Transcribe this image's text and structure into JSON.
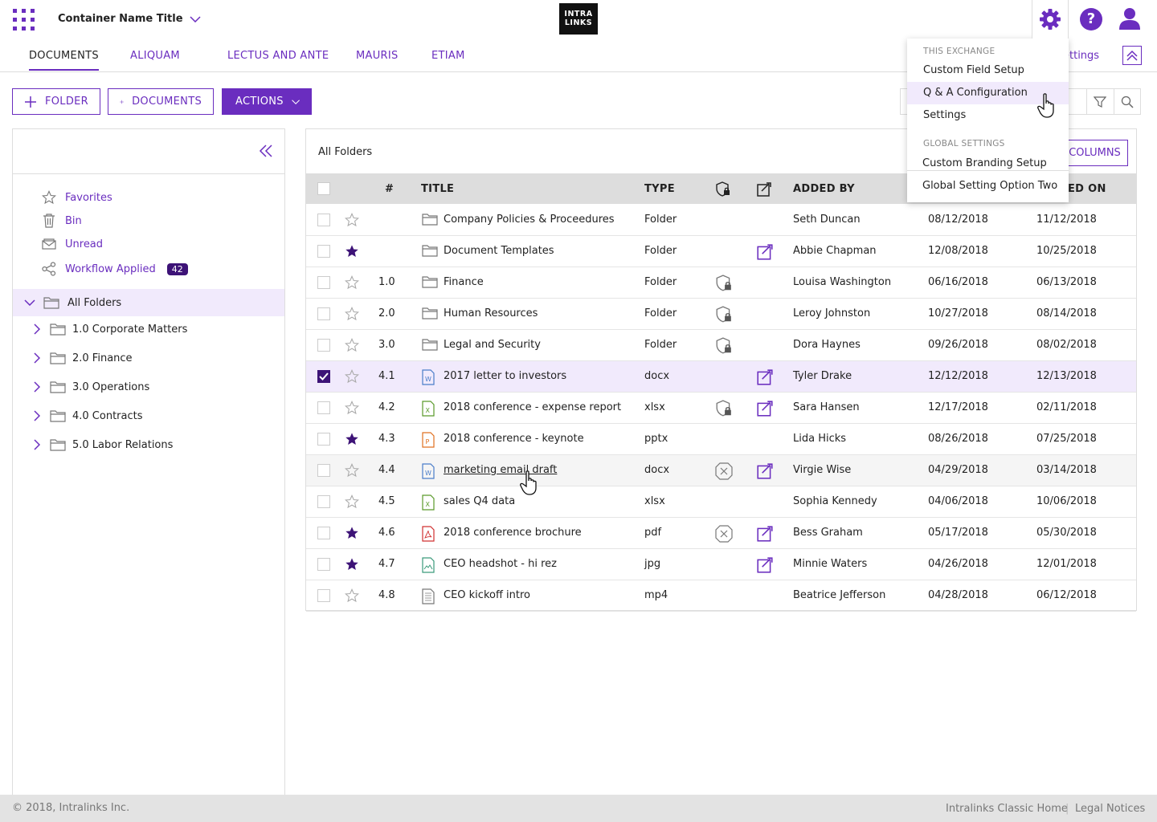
{
  "header": {
    "container_name": "Container Name Title",
    "logo_line1": "INTRA",
    "logo_line2": "LINKS",
    "help_label": "?"
  },
  "tabs": [
    {
      "label": "DOCUMENTS",
      "active": true
    },
    {
      "label": "ALIQUAM"
    },
    {
      "label": "LECTUS AND ANTE"
    },
    {
      "label": "MAURIS"
    },
    {
      "label": "ETIAM"
    }
  ],
  "settings_link": "ettings",
  "toolbar": {
    "folder_label": "FOLDER",
    "documents_label": "DOCUMENTS",
    "actions_label": "ACTIONS"
  },
  "sidebar": {
    "quick_links": [
      {
        "label": "Favorites",
        "icon": "star-icon"
      },
      {
        "label": "Bin",
        "icon": "trash-icon"
      },
      {
        "label": "Unread",
        "icon": "envelope-icon"
      },
      {
        "label": "Workflow Applied",
        "icon": "share-icon",
        "badge": "42"
      }
    ],
    "all_folders_label": "All Folders",
    "folders": [
      {
        "label": "1.0 Corporate Matters"
      },
      {
        "label": "2.0 Finance"
      },
      {
        "label": "3.0 Operations"
      },
      {
        "label": "4.0 Contracts"
      },
      {
        "label": "5.0 Labor Relations"
      }
    ]
  },
  "main": {
    "breadcrumb": "All Folders",
    "columns_button": "COLUMNS",
    "headers": {
      "num": "#",
      "title": "TITLE",
      "type": "TYPE",
      "added_by": "ADDED BY",
      "modified_on": "ED ON"
    },
    "rows": [
      {
        "num": "",
        "title": "Company Policies & Proceedures",
        "type": "Folder",
        "added_by": "Seth Duncan",
        "added_on": "08/12/2018",
        "modified_on": "11/12/2018",
        "starred": false,
        "checked": false,
        "icon": "folder-icon",
        "security": "",
        "workflow": false
      },
      {
        "num": "",
        "title": "Document Templates",
        "type": "Folder",
        "added_by": "Abbie Chapman",
        "added_on": "12/08/2018",
        "modified_on": "10/25/2018",
        "starred": true,
        "checked": false,
        "icon": "folder-icon",
        "security": "",
        "workflow": true
      },
      {
        "num": "1.0",
        "title": "Finance",
        "type": "Folder",
        "added_by": "Louisa Washington",
        "added_on": "06/16/2018",
        "modified_on": "06/13/2018",
        "starred": false,
        "checked": false,
        "icon": "folder-icon",
        "security": "lock",
        "workflow": false
      },
      {
        "num": "2.0",
        "title": "Human Resources",
        "type": "Folder",
        "added_by": "Leroy Johnston",
        "added_on": "10/27/2018",
        "modified_on": "08/14/2018",
        "starred": false,
        "checked": false,
        "icon": "folder-icon",
        "security": "lock",
        "workflow": false
      },
      {
        "num": "3.0",
        "title": "Legal and Security",
        "type": "Folder",
        "added_by": "Dora Haynes",
        "added_on": "09/26/2018",
        "modified_on": "08/02/2018",
        "starred": false,
        "checked": false,
        "icon": "folder-icon",
        "security": "lock",
        "workflow": false
      },
      {
        "num": "4.1",
        "title": "2017 letter to investors",
        "type": "docx",
        "added_by": "Tyler Drake",
        "added_on": "12/12/2018",
        "modified_on": "12/13/2018",
        "starred": false,
        "checked": true,
        "icon": "word-file-icon",
        "security": "",
        "workflow": true
      },
      {
        "num": "4.2",
        "title": "2018 conference - expense report",
        "type": "xlsx",
        "added_by": "Sara Hansen",
        "added_on": "12/17/2018",
        "modified_on": "02/11/2018",
        "starred": false,
        "checked": false,
        "icon": "excel-file-icon",
        "security": "lock",
        "workflow": true
      },
      {
        "num": "4.3",
        "title": "2018 conference - keynote",
        "type": "pptx",
        "added_by": "Lida Hicks",
        "added_on": "08/26/2018",
        "modified_on": "07/25/2018",
        "starred": true,
        "checked": false,
        "icon": "powerpoint-file-icon",
        "security": "",
        "workflow": false
      },
      {
        "num": "4.4",
        "title": "marketing email draft",
        "type": "docx",
        "added_by": "Virgie Wise",
        "added_on": "04/29/2018",
        "modified_on": "03/14/2018",
        "starred": false,
        "checked": false,
        "icon": "word-file-icon",
        "security": "x",
        "workflow": true
      },
      {
        "num": "4.5",
        "title": "sales Q4 data",
        "type": "xlsx",
        "added_by": "Sophia Kennedy",
        "added_on": "04/06/2018",
        "modified_on": "10/06/2018",
        "starred": false,
        "checked": false,
        "icon": "excel-file-icon",
        "security": "",
        "workflow": false
      },
      {
        "num": "4.6",
        "title": "2018 conference brochure",
        "type": "pdf",
        "added_by": "Bess Graham",
        "added_on": "05/17/2018",
        "modified_on": "05/30/2018",
        "starred": true,
        "checked": false,
        "icon": "pdf-file-icon",
        "security": "x",
        "workflow": true
      },
      {
        "num": "4.7",
        "title": "CEO headshot - hi rez",
        "type": "jpg",
        "added_by": "Minnie Waters",
        "added_on": "04/26/2018",
        "modified_on": "12/01/2018",
        "starred": true,
        "checked": false,
        "icon": "image-file-icon",
        "security": "",
        "workflow": true
      },
      {
        "num": "4.8",
        "title": "CEO kickoff intro",
        "type": "mp4",
        "added_by": "Beatrice Jefferson",
        "added_on": "04/28/2018",
        "modified_on": "06/12/2018",
        "starred": false,
        "checked": false,
        "icon": "video-file-icon",
        "security": "",
        "workflow": false
      }
    ]
  },
  "settings_menu": {
    "section1": "THIS EXCHANGE",
    "item1": "Custom Field Setup",
    "item2": "Q & A Configuration",
    "item3": "Settings",
    "section2": "GLOBAL SETTINGS",
    "item4": "Custom Branding Setup",
    "item5": "Global Setting Option Two"
  },
  "footer": {
    "copyright": "© 2018, Intralinks Inc.",
    "link1": "Intralinks Classic Home",
    "separator": "|",
    "link2": "Legal Notices"
  },
  "colors": {
    "accent": "#6a2dbf",
    "accent_dark": "#3d1377",
    "selected_row": "#f1eafc"
  }
}
